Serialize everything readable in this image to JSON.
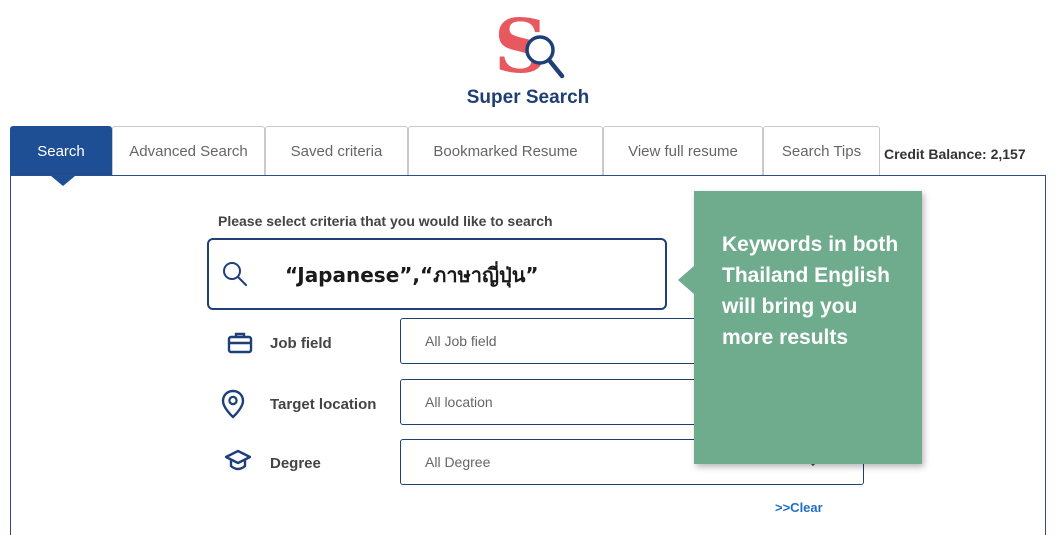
{
  "brand": {
    "name": "Super Search",
    "logo_letter": "S",
    "logo_icon": "magnifier-icon"
  },
  "tabs": [
    {
      "label": "Search",
      "active": true
    },
    {
      "label": "Advanced Search",
      "active": false
    },
    {
      "label": "Saved criteria",
      "active": false
    },
    {
      "label": "Bookmarked Resume",
      "active": false
    },
    {
      "label": "View full resume",
      "active": false
    },
    {
      "label": "Search Tips",
      "active": false
    }
  ],
  "credit": "Credit Balance: 2,157",
  "form": {
    "prompt": "Please select criteria that you would like to search",
    "keyword_value": "“Japanese”,“ภาษาญี่ปุ่น”",
    "criteria": [
      {
        "label": "Job field",
        "value": "All Job field",
        "icon": "briefcase-icon"
      },
      {
        "label": "Target location",
        "value": "All location",
        "icon": "location-pin-icon"
      },
      {
        "label": "Degree",
        "value": "All Degree",
        "icon": "graduation-cap-icon"
      }
    ],
    "clear": ">>Clear"
  },
  "tooltip": {
    "text": "Keywords in both Thailand English will bring you more results"
  },
  "colors": {
    "primary": "#1e4f94",
    "logo_red": "#e8585f",
    "tooltip_green": "#6fac8e",
    "link": "#1e6fc4"
  }
}
